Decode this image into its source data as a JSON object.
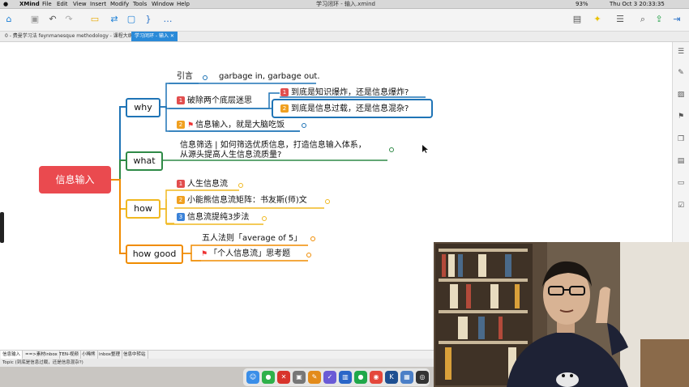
{
  "menubar": {
    "apple": "",
    "app": "XMind",
    "items": [
      "File",
      "Edit",
      "View",
      "Insert",
      "Modify",
      "Tools",
      "Window",
      "Help"
    ],
    "title": "学习闭环 - 输入.xmind",
    "battery": "93%",
    "datetime": "Thu Oct 3   20:33:35"
  },
  "tabs": [
    {
      "label": "0 - 费曼学习法 feynmanesque methodology - 课程大纲"
    },
    {
      "label": "学习闭环 - 输入"
    }
  ],
  "map": {
    "root": "信息输入",
    "why": {
      "label": "why",
      "intro": "引言",
      "intro_note": "garbage in, garbage out.",
      "myth": "破除两个底层迷思",
      "myth_badge": "1",
      "myth_a": "到底是知识爆炸，还是信息爆炸?",
      "myth_a_badge": "1",
      "myth_b": "到底是信息过载，还是信息混杂?",
      "myth_b_badge": "2",
      "input": "信息输入，就是大脑吃饭",
      "input_badge": "2"
    },
    "what": {
      "label": "what",
      "line1": "信息筛选 | 如何筛选优质信息，打造信息输入体系，",
      "line2": "从源头提高人生信息流质量?"
    },
    "how": {
      "label": "how",
      "items": [
        {
          "badge": "1",
          "text": "人生信息流"
        },
        {
          "badge": "2",
          "text": "小能熊信息流矩阵：书友斯(师)文"
        },
        {
          "badge": "3",
          "text": "信息流提纯3步法"
        }
      ]
    },
    "howgood": {
      "label": "how good",
      "item1": "五人法则「average of 5」",
      "item2": "「个人信息流」思考题"
    }
  },
  "sheets": [
    "信息输入",
    "==>素材inbox",
    "TEN-视频",
    "小稀熊",
    "inbox整理",
    "信息中转站"
  ],
  "status": "Topic (到底是信息过载，还是信息混杂?)",
  "colors": {
    "root": "#ea4a4f",
    "why": "#1f74b6",
    "what": "#2f8a47",
    "how": "#f0b820",
    "howgood": "#f08c00"
  }
}
